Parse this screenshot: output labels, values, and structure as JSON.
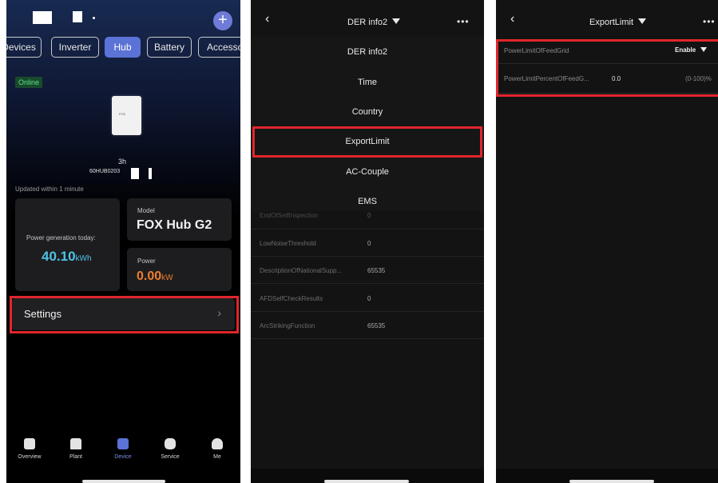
{
  "panel1": {
    "tabs": [
      "Devices",
      "Inverter",
      "Hub",
      "Battery",
      "Accesso"
    ],
    "active_tab": "Hub",
    "status": "Online",
    "device_logo": "FOX",
    "time_ago": "3h",
    "serial": "60HUB0203",
    "updated": "Updated  within 1 minute",
    "power_gen_label": "Power generation today:",
    "power_gen_value": "40.10",
    "power_gen_unit": "kWh",
    "model_label": "Model",
    "model_value": "FOX Hub G2",
    "power_label": "Power",
    "power_value": "0.00",
    "power_unit": "kW",
    "settings_label": "Settings",
    "nav": [
      {
        "label": "Overview",
        "icon": "chart-icon"
      },
      {
        "label": "Plant",
        "icon": "house-icon"
      },
      {
        "label": "Device",
        "icon": "device-icon"
      },
      {
        "label": "Service",
        "icon": "grid-icon"
      },
      {
        "label": "Me",
        "icon": "person-icon"
      }
    ],
    "active_nav": "Device",
    "colors": {
      "accent": "#5b72d6",
      "gen_value": "#4fc3e6",
      "power_value": "#ef7d2f",
      "highlight": "#e0262b"
    }
  },
  "panel2": {
    "title": "DER info2",
    "menu": [
      "DER info2",
      "Time",
      "Country",
      "ExportLimit",
      "AC-Couple",
      "EMS"
    ],
    "selected_menu": "ExportLimit",
    "partial_row": {
      "key": "EndOfSelfInspection",
      "value": "0"
    },
    "rows": [
      {
        "key": "LowNoiseThreshold",
        "value": "0"
      },
      {
        "key": "DescriptionOfNationalSupp...",
        "value": "65535"
      },
      {
        "key": "AFDSelfCheckResults",
        "value": "0"
      },
      {
        "key": "ArcStrikingFunction",
        "value": "65535"
      }
    ]
  },
  "panel3": {
    "title": "ExportLimit",
    "rows": [
      {
        "key": "PowerLimitOfFeedGrid",
        "value": "Enable"
      },
      {
        "key": "PowerLimitPercentOfFeedG...",
        "value": "0.0",
        "range": "(0-100)%"
      }
    ]
  }
}
